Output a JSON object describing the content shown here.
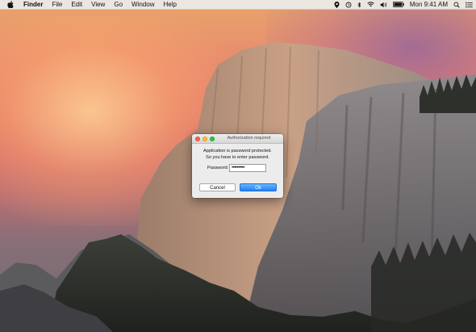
{
  "menubar": {
    "app_name": "Finder",
    "items": [
      "File",
      "Edit",
      "View",
      "Go",
      "Window",
      "Help"
    ],
    "clock": "Mon 9:41 AM",
    "status_icons": [
      "location-icon",
      "time-machine-icon",
      "bluetooth-icon",
      "wifi-icon",
      "volume-icon",
      "battery-icon",
      "spotlight-icon",
      "notification-center-icon"
    ]
  },
  "dialog": {
    "title": "Authorization required",
    "message_line1": "Application is password protected.",
    "message_line2": "So you have to enter password.",
    "password_label": "Password:",
    "password_value": "••••••••••",
    "cancel_label": "Cancel",
    "ok_label": "Ok"
  },
  "colors": {
    "ok_button": "#1e83f7",
    "close_light": "#fc5f57",
    "minimize_light": "#fdbc2e",
    "zoom_light": "#28c840"
  }
}
